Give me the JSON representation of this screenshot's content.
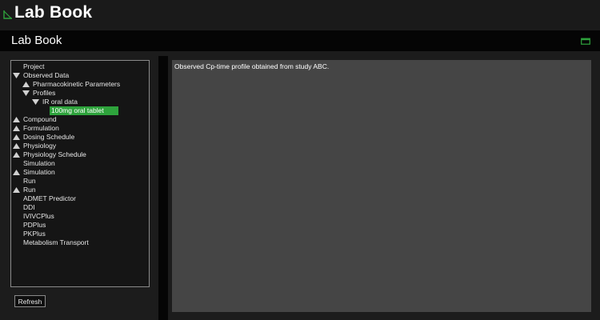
{
  "app": {
    "title": "Lab Book"
  },
  "panel": {
    "title": "Lab Book"
  },
  "tree": {
    "items": [
      {
        "label": "Project",
        "expand": "none"
      },
      {
        "label": "Observed Data",
        "expand": "expanded"
      },
      {
        "label": "Pharmacokinetic Parameters",
        "expand": "collapsed"
      },
      {
        "label": "Profiles",
        "expand": "expanded"
      },
      {
        "label": "IR oral data",
        "expand": "expanded"
      },
      {
        "label": "100mg oral tablet",
        "expand": "none",
        "selected": true
      },
      {
        "label": "Compound",
        "expand": "collapsed"
      },
      {
        "label": "Formulation",
        "expand": "collapsed"
      },
      {
        "label": "Dosing Schedule",
        "expand": "collapsed"
      },
      {
        "label": "Physiology",
        "expand": "collapsed"
      },
      {
        "label": "Physiology Schedule",
        "expand": "collapsed"
      },
      {
        "label": "Simulation",
        "expand": "none"
      },
      {
        "label": "Simulation",
        "expand": "collapsed"
      },
      {
        "label": "Run",
        "expand": "none"
      },
      {
        "label": "Run",
        "expand": "collapsed"
      },
      {
        "label": "ADMET Predictor",
        "expand": "none"
      },
      {
        "label": "DDI",
        "expand": "none"
      },
      {
        "label": "IVIVCPlus",
        "expand": "none"
      },
      {
        "label": "PDPlus",
        "expand": "none"
      },
      {
        "label": "PKPlus",
        "expand": "none"
      },
      {
        "label": "Metabolism Transport",
        "expand": "none"
      }
    ]
  },
  "refresh_label": "Refresh",
  "detail": {
    "text": "Observed Cp-time profile obtained from study ABC."
  },
  "colors": {
    "accent": "#2ea33c",
    "pane": "#454545",
    "header_bar": "#050505"
  }
}
